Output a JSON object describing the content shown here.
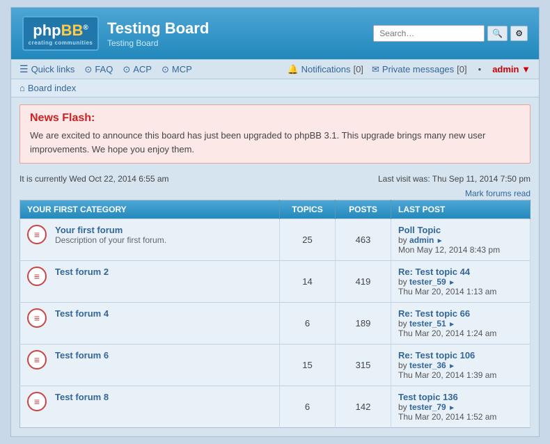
{
  "header": {
    "logo_text": "phpBB",
    "logo_sub": "creating communities",
    "logo_reg": "®",
    "board_title": "Testing Board",
    "board_subtitle": "Testing Board"
  },
  "search": {
    "placeholder": "Search…",
    "search_label": "🔍",
    "advanced_label": "⚙"
  },
  "navbar": {
    "quick_links": "Quick links",
    "faq": "FAQ",
    "acp": "ACP",
    "mcp": "MCP",
    "notifications": "Notifications",
    "notif_count": "[0]",
    "private_messages": "Private messages",
    "pm_count": "[0]",
    "admin_user": "admin",
    "admin_arrow": "▼",
    "dot": "•"
  },
  "breadcrumb": {
    "home_icon": "⌂",
    "board_index": "Board index"
  },
  "news_flash": {
    "title": "News Flash:",
    "body": "We are excited to announce this board has just been upgraded to phpBB 3.1. This upgrade brings many new user improvements. We hope you enjoy them."
  },
  "status_bar": {
    "current_time": "It is currently Wed Oct 22, 2014 6:55 am",
    "last_visit": "Last visit was: Thu Sep 11, 2014 7:50 pm"
  },
  "mark_read": "Mark forums read",
  "table": {
    "category": "YOUR FIRST CATEGORY",
    "col_topics": "TOPICS",
    "col_posts": "POSTS",
    "col_lastpost": "LAST POST",
    "forums": [
      {
        "id": "forum1",
        "name": "Your first forum",
        "desc": "Description of your first forum.",
        "topics": "25",
        "posts": "463",
        "lastpost_title": "Poll Topic",
        "lastpost_by": "by",
        "lastpost_user": "admin",
        "lastpost_date": "Mon May 12, 2014 8:43 pm"
      },
      {
        "id": "forum2",
        "name": "Test forum 2",
        "desc": "",
        "topics": "14",
        "posts": "419",
        "lastpost_title": "Re: Test topic 44",
        "lastpost_by": "by",
        "lastpost_user": "tester_59",
        "lastpost_date": "Thu Mar 20, 2014 1:13 am"
      },
      {
        "id": "forum4",
        "name": "Test forum 4",
        "desc": "",
        "topics": "6",
        "posts": "189",
        "lastpost_title": "Re: Test topic 66",
        "lastpost_by": "by",
        "lastpost_user": "tester_51",
        "lastpost_date": "Thu Mar 20, 2014 1:24 am"
      },
      {
        "id": "forum6",
        "name": "Test forum 6",
        "desc": "",
        "topics": "15",
        "posts": "315",
        "lastpost_title": "Re: Test topic 106",
        "lastpost_by": "by",
        "lastpost_user": "tester_36",
        "lastpost_date": "Thu Mar 20, 2014 1:39 am"
      },
      {
        "id": "forum8",
        "name": "Test forum 8",
        "desc": "",
        "topics": "6",
        "posts": "142",
        "lastpost_title": "Test topic 136",
        "lastpost_by": "by",
        "lastpost_user": "tester_79",
        "lastpost_date": "Thu Mar 20, 2014 1:52 am"
      }
    ]
  }
}
